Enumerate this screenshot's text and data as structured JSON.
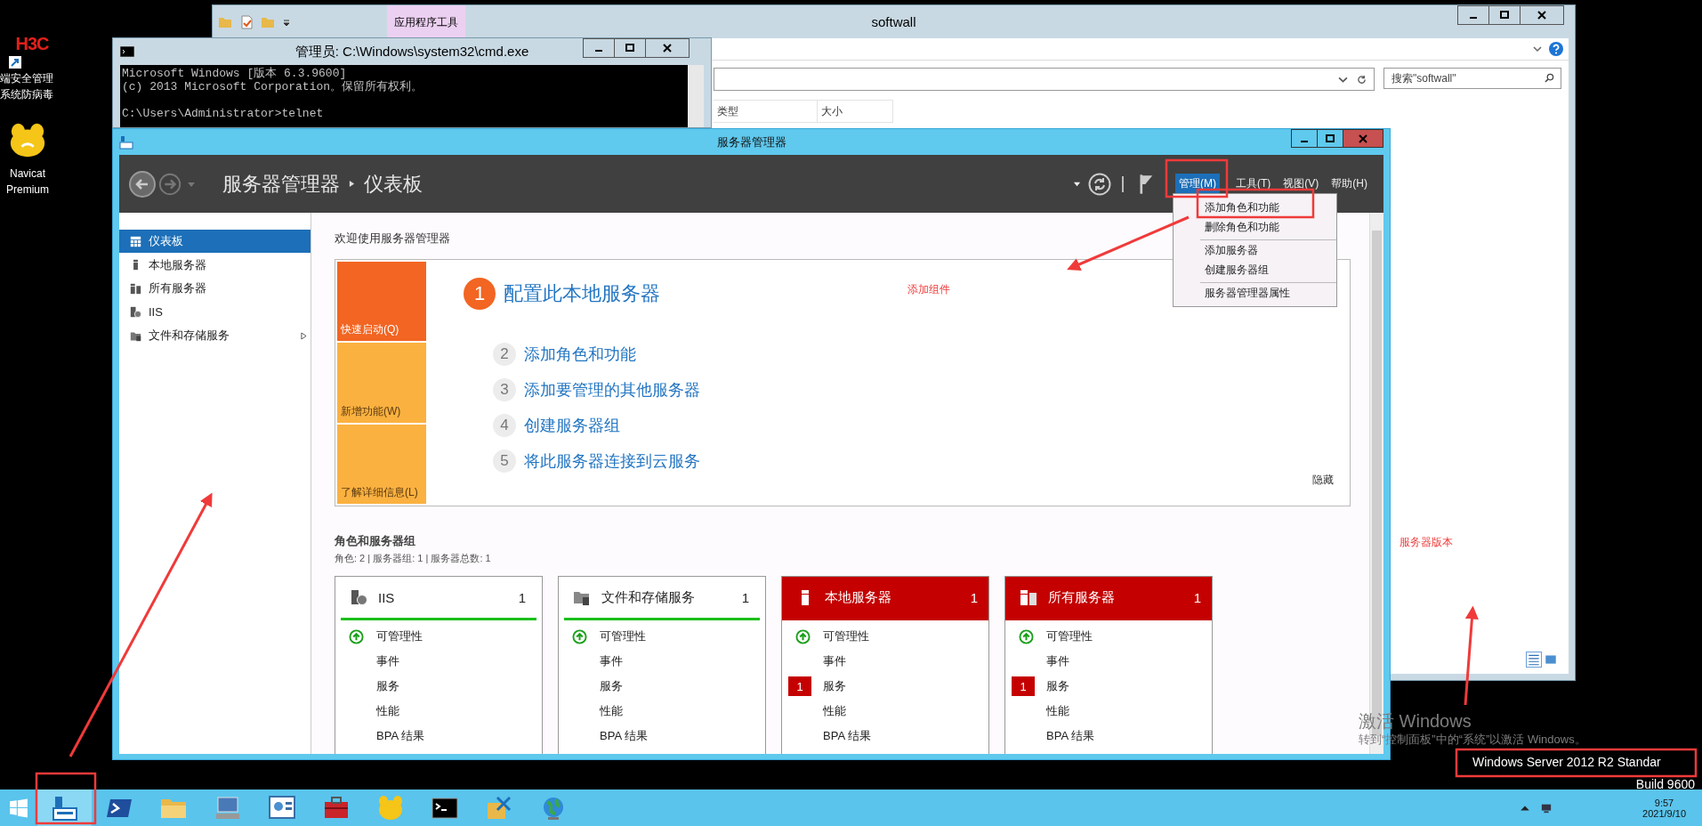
{
  "desktop_icons": [
    {
      "kind": "h3c",
      "logo": "H3C",
      "label_lines": [
        "端安全管理",
        "系统防病毒"
      ]
    },
    {
      "kind": "navicat",
      "label_lines": [
        "Navicat",
        "Premium"
      ]
    }
  ],
  "explorer": {
    "title": "softwall",
    "ribbon_tab": "应用程序工具",
    "search": {
      "placeholder": "搜索\"softwall\""
    },
    "columns": [
      "类型",
      "大小"
    ]
  },
  "cmd": {
    "title": "管理员: C:\\Windows\\system32\\cmd.exe",
    "blocks": [
      {
        "lines": [
          "Microsoft Windows [版本 6.3.9600]",
          "(c) 2013 Microsoft Corporation。保留所有权利。"
        ]
      },
      {
        "lines": [
          "C:\\Users\\Administrator>telnet"
        ]
      }
    ]
  },
  "server_manager": {
    "title": "服务器管理器",
    "breadcrumb": [
      "服务器管理器",
      "仪表板"
    ],
    "menu": [
      {
        "label": "管理(M)",
        "selected": true
      },
      {
        "label": "工具(T)",
        "selected": false
      },
      {
        "label": "视图(V)",
        "selected": false
      },
      {
        "label": "帮助(H)",
        "selected": false
      }
    ],
    "dropdown": [
      {
        "label": "添加角色和功能",
        "divider_before": false
      },
      {
        "label": "删除角色和功能",
        "divider_before": false
      },
      {
        "label": "添加服务器",
        "divider_before": true
      },
      {
        "label": "创建服务器组",
        "divider_before": false
      },
      {
        "label": "服务器管理器属性",
        "divider_before": true
      }
    ],
    "sidebar": [
      {
        "label": "仪表板",
        "kind": "dashboard",
        "selected": true,
        "expandable": false
      },
      {
        "label": "本地服务器",
        "kind": "server",
        "selected": false,
        "expandable": false
      },
      {
        "label": "所有服务器",
        "kind": "servers",
        "selected": false,
        "expandable": false
      },
      {
        "label": "IIS",
        "kind": "iis",
        "selected": false,
        "expandable": false
      },
      {
        "label": "文件和存储服务",
        "kind": "storage",
        "selected": false,
        "expandable": true
      }
    ],
    "welcome_title": "欢迎使用服务器管理器",
    "quick_tiles": [
      {
        "label": "快速启动(Q)",
        "selected": true
      },
      {
        "label": "新增功能(W)",
        "selected": false
      },
      {
        "label": "了解详细信息(L)",
        "selected": false
      }
    ],
    "steps": [
      {
        "number": "1",
        "label": "配置此本地服务器",
        "kind": "primary"
      },
      {
        "number": "2",
        "label": "添加角色和功能",
        "kind": "step"
      },
      {
        "number": "3",
        "label": "添加要管理的其他服务器",
        "kind": "step"
      },
      {
        "number": "4",
        "label": "创建服务器组",
        "kind": "step"
      },
      {
        "number": "5",
        "label": "将此服务器连接到云服务",
        "kind": "step"
      }
    ],
    "hide_link": "隐藏",
    "roles_title": "角色和服务器组",
    "roles_summary": "角色: 2 | 服务器组: 1 | 服务器总数: 1",
    "role_tiles": [
      {
        "kind": "iis",
        "title": "IIS",
        "count": "1",
        "alert": false,
        "rows": [
          {
            "label": "可管理性",
            "kind": "ok"
          },
          {
            "label": "事件",
            "kind": "plain"
          },
          {
            "label": "服务",
            "kind": "plain"
          },
          {
            "label": "性能",
            "kind": "plain"
          },
          {
            "label": "BPA 结果",
            "kind": "plain"
          }
        ]
      },
      {
        "kind": "storage",
        "title": "文件和存储服务",
        "count": "1",
        "alert": false,
        "rows": [
          {
            "label": "可管理性",
            "kind": "ok"
          },
          {
            "label": "事件",
            "kind": "plain"
          },
          {
            "label": "服务",
            "kind": "plain"
          },
          {
            "label": "性能",
            "kind": "plain"
          },
          {
            "label": "BPA 结果",
            "kind": "plain"
          }
        ]
      },
      {
        "kind": "server",
        "title": "本地服务器",
        "count": "1",
        "alert": true,
        "rows": [
          {
            "label": "可管理性",
            "kind": "ok"
          },
          {
            "label": "事件",
            "kind": "plain"
          },
          {
            "label": "服务",
            "kind": "count",
            "badge": "1"
          },
          {
            "label": "性能",
            "kind": "plain"
          },
          {
            "label": "BPA 结果",
            "kind": "plain"
          }
        ]
      },
      {
        "kind": "servers",
        "title": "所有服务器",
        "count": "1",
        "alert": true,
        "rows": [
          {
            "label": "可管理性",
            "kind": "ok"
          },
          {
            "label": "事件",
            "kind": "plain"
          },
          {
            "label": "服务",
            "kind": "count",
            "badge": "1"
          },
          {
            "label": "性能",
            "kind": "plain"
          },
          {
            "label": "BPA 结果",
            "kind": "plain"
          }
        ]
      }
    ]
  },
  "annotations": [
    {
      "text": "添加组件",
      "kind": "components"
    },
    {
      "text": "服务器版本",
      "kind": "version"
    }
  ],
  "activation": {
    "title": "激活 Windows",
    "message": "转到“控制面板”中的“系统”以激活 Windows。"
  },
  "edition": "Windows Server 2012 R2 Standar",
  "build": "Build 9600",
  "taskbar": {
    "apps": [
      {
        "kind": "server",
        "selected": true
      },
      {
        "kind": "powershell",
        "selected": false
      },
      {
        "kind": "folder",
        "selected": false
      },
      {
        "kind": "computer",
        "selected": false
      },
      {
        "kind": "panel",
        "selected": false
      },
      {
        "kind": "toolbox",
        "selected": false
      },
      {
        "kind": "navicat",
        "selected": false
      },
      {
        "kind": "cmd",
        "selected": false
      },
      {
        "kind": "tools",
        "selected": false
      },
      {
        "kind": "globe",
        "selected": false
      }
    ],
    "clock": {
      "time": "9:57",
      "date": "2021/9/10"
    }
  }
}
